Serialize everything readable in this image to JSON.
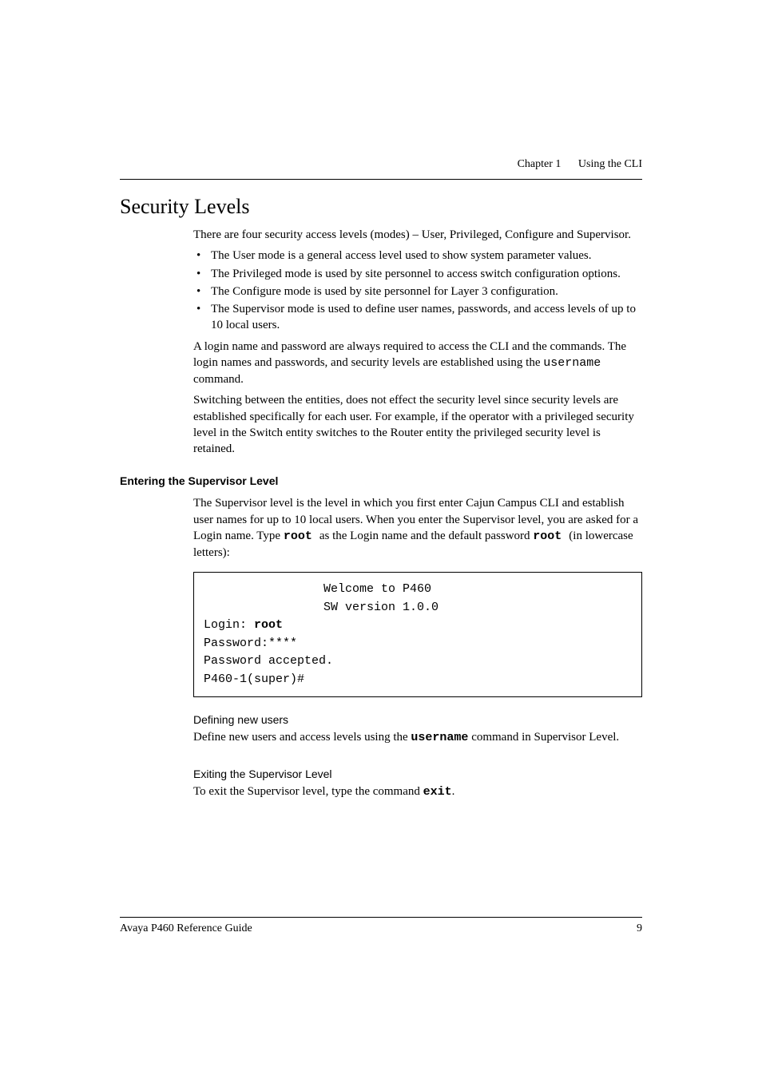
{
  "header": {
    "chapter": "Chapter 1",
    "title": "Using the CLI"
  },
  "section_title": "Security Levels",
  "intro_para": "There are four security access levels (modes) – User, Privileged, Configure and Supervisor.",
  "bullets": [
    "The User mode is a general access level used to show system parameter values.",
    "The Privileged mode is used by site personnel to access switch configuration options.",
    "The Configure mode is used by site personnel for Layer 3 configuration.",
    "The Supervisor mode is used to define user names, passwords, and access levels of up to 10 local users."
  ],
  "login_para_pre": "A login name and password are always required to access the CLI and the commands. The login names and passwords, and security levels are established using the ",
  "login_para_cmd": "username",
  "login_para_post": " command.",
  "switching_para": "Switching between the entities, does not effect the security level since security levels are established specifically for each user. For example, if the operator with a privileged security level in the Switch entity switches to the Router entity the privileged security level is retained.",
  "supervisor": {
    "heading": "Entering the Supervisor Level",
    "para_pre": "The Supervisor level is the level in which you first enter Cajun Campus CLI and establish user names for up to 10 local users. When you enter the Supervisor level, you are asked for a Login name. Type ",
    "cmd1": " root ",
    "para_mid": " as the Login name and the default password ",
    "cmd2": " root ",
    "para_post": " (in lowercase letters):"
  },
  "codebox": {
    "welcome": "Welcome to P460",
    "version": "SW version 1.0.0",
    "login_label": "Login: ",
    "login_value": "root",
    "password_line": "Password:****",
    "accepted": "Password accepted.",
    "prompt": "P460-1(super)#"
  },
  "defining": {
    "heading": "Defining new users",
    "para_pre": "Define new users and access levels using the ",
    "cmd": "username",
    "para_post": " command in Supervisor Level."
  },
  "exiting": {
    "heading": "Exiting the Supervisor Level",
    "para_pre": "To exit the Supervisor level, type the command ",
    "cmd": " exit",
    "para_post": "."
  },
  "footer": {
    "left": "Avaya P460 Reference Guide",
    "right": "9"
  }
}
